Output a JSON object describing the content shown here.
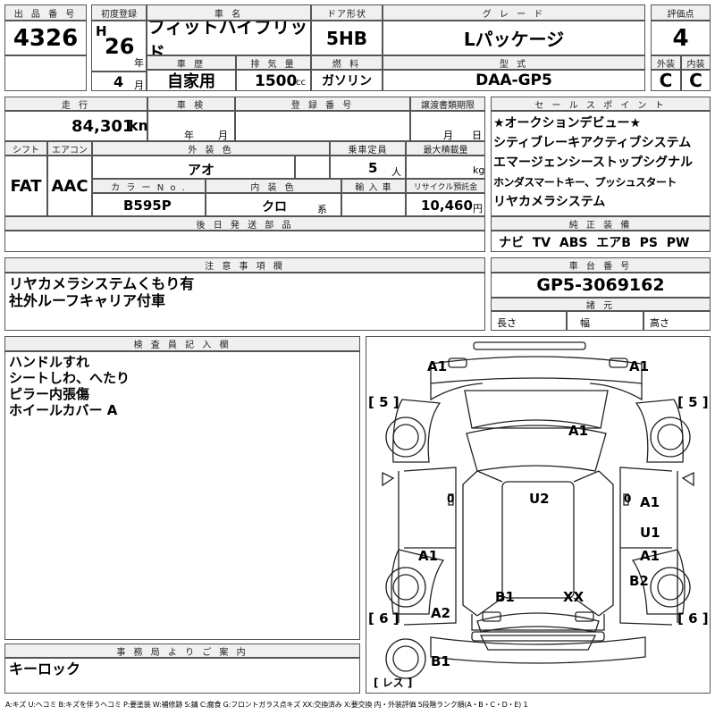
{
  "header": {
    "lot_label": "出 品 番 号",
    "lot_value": "4326",
    "first_reg_label": "初度登録",
    "era": "H",
    "year": "26",
    "year_unit": "年",
    "month": "4",
    "month_unit": "月",
    "name_label": "車  名",
    "name_value": "フィットハイブリッド",
    "door_label": "ドア形状",
    "door_value": "5HB",
    "grade_label": "グ レ ー ド",
    "grade_value": "Lパッケージ",
    "score_label": "評価点",
    "score_value": "4",
    "history_label": "車 歴",
    "history_value": "自家用",
    "displacement_label": "排 気 量",
    "displacement_value": "1500",
    "displacement_unit": "cc",
    "fuel_label": "燃 料",
    "fuel_value": "ガソリン",
    "model_label": "型 式",
    "model_value": "DAA-GP5",
    "exterior_label": "外装",
    "exterior_value": "C",
    "interior_label": "内装",
    "interior_value": "C"
  },
  "specs": {
    "mileage_label": "走 行",
    "mileage_value": "84,301",
    "mileage_unit": "km",
    "inspection_label": "車 検",
    "inspection_year_unit": "年",
    "inspection_month_unit": "月",
    "registration_label": "登 録 番 号",
    "transfer_label": "譲渡書類期限",
    "transfer_month_unit": "月",
    "transfer_day_unit": "日",
    "shift_label": "シフト",
    "shift_value": "FAT",
    "aircon_label": "エアコン",
    "aircon_value": "AAC",
    "color_label": "外 装 色",
    "color_value": "アオ",
    "seats_label": "乗車定員",
    "seats_value": "5",
    "seats_unit": "人",
    "load_label": "最大積載量",
    "load_unit": "kg",
    "color_no_label": "カ ラ ー N o .",
    "color_no_value": "B595P",
    "interior_color_label": "内 装 色",
    "interior_color_value": "クロ",
    "interior_color_unit": "系",
    "import_label": "輸 入 車",
    "recycle_label": "リサイクル預託金",
    "recycle_value": "10,460",
    "recycle_unit": "円",
    "later_parts_label": "後 日 発 送 部 品"
  },
  "sales_points": {
    "label": "セ ー ル ス ポ イ ン ト",
    "lines": [
      "★オークションデビュー★",
      "シティブレーキアクティブシステム",
      "エマージェンシーストップシグナル",
      "ホンダスマートキー、プッシュスタート",
      "リヤカメラシステム"
    ]
  },
  "equipment": {
    "label": "純 正 装 備",
    "value": "ナビ  TV  ABS  エアB  PS  PW"
  },
  "notes": {
    "label": "注 意 事 項 欄",
    "text": "リヤカメラシステムくもり有\n社外ルーフキャリア付車"
  },
  "chassis": {
    "label": "車 台 番 号",
    "value": "GP5-3069162",
    "spec_label": "諸 元",
    "length_label": "長さ",
    "width_label": "幅",
    "height_label": "高さ"
  },
  "inspector": {
    "label": "検 査 員 記 入 欄",
    "text": "ハンドルすれ\nシートしわ、へたり\nピラー内張傷\nホイールカバー A"
  },
  "office": {
    "label": "事 務 局 よ り ご 案 内",
    "text": "キーロック"
  },
  "diagram": {
    "marks": {
      "a1_front_left": "A1",
      "a1_front_right": "A1",
      "a1_hood": "A1",
      "a1_right_front_door": "A1",
      "a1_right_rear_door": "A1",
      "a1_left_rear": "A1",
      "u2_roof": "U2",
      "u1_right_door": "U1",
      "b2_right_rear": "B2",
      "b1_trunk": "B1",
      "xx_trunk": "XX",
      "a2_left_rear": "A2",
      "b1_rear_bumper": "B1",
      "zero_left": "0",
      "zero_right": "0"
    },
    "tire_fl": "[ 5 ]",
    "tire_fr": "[ 5 ]",
    "tire_rl": "[ 6 ]",
    "tire_rr": "[ 6 ]",
    "spare": "[ レス ]"
  },
  "legend": "A:キズ U:ヘコミ B:キズを伴うヘコミ P:要塗装 W:補修跡 S:錆 C:腐食 G:フロントガラス点キズ XX:交換済み X:要交換  内・外装評価 5段階ランク順(A・B・C・D・E) 1"
}
